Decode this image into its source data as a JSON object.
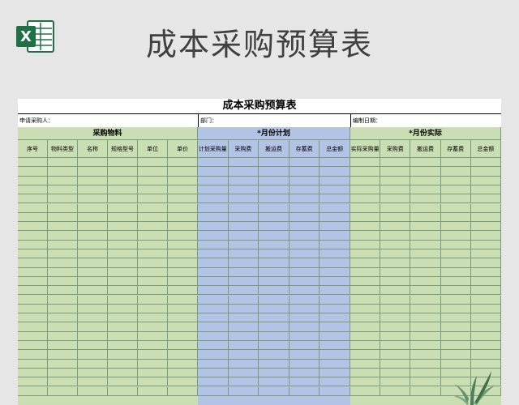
{
  "page": {
    "title": "成本采购预算表"
  },
  "icons": {
    "app": "excel-icon",
    "decor": "plant-icon"
  },
  "colors": {
    "excel_green": "#1e7145",
    "grid_green": "#c9deb2",
    "grid_blue": "#b2c3e6"
  },
  "sheet": {
    "title": "成本采购预算表",
    "info": {
      "applicant_label": "申请采购人：",
      "department_label": "部门：",
      "date_label": "编制日期："
    },
    "groups": [
      {
        "label": "采购物料",
        "columns": [
          "序号",
          "物料类型",
          "名称",
          "规格型号",
          "单位",
          "单价"
        ]
      },
      {
        "label": "*月份计划",
        "columns": [
          "计划采购量",
          "采购费",
          "搬运费",
          "存蓄费",
          "总金额"
        ]
      },
      {
        "label": "*月份实际",
        "columns": [
          "实际采购量",
          "采购费",
          "搬运费",
          "存蓄费",
          "总金额"
        ]
      }
    ]
  }
}
